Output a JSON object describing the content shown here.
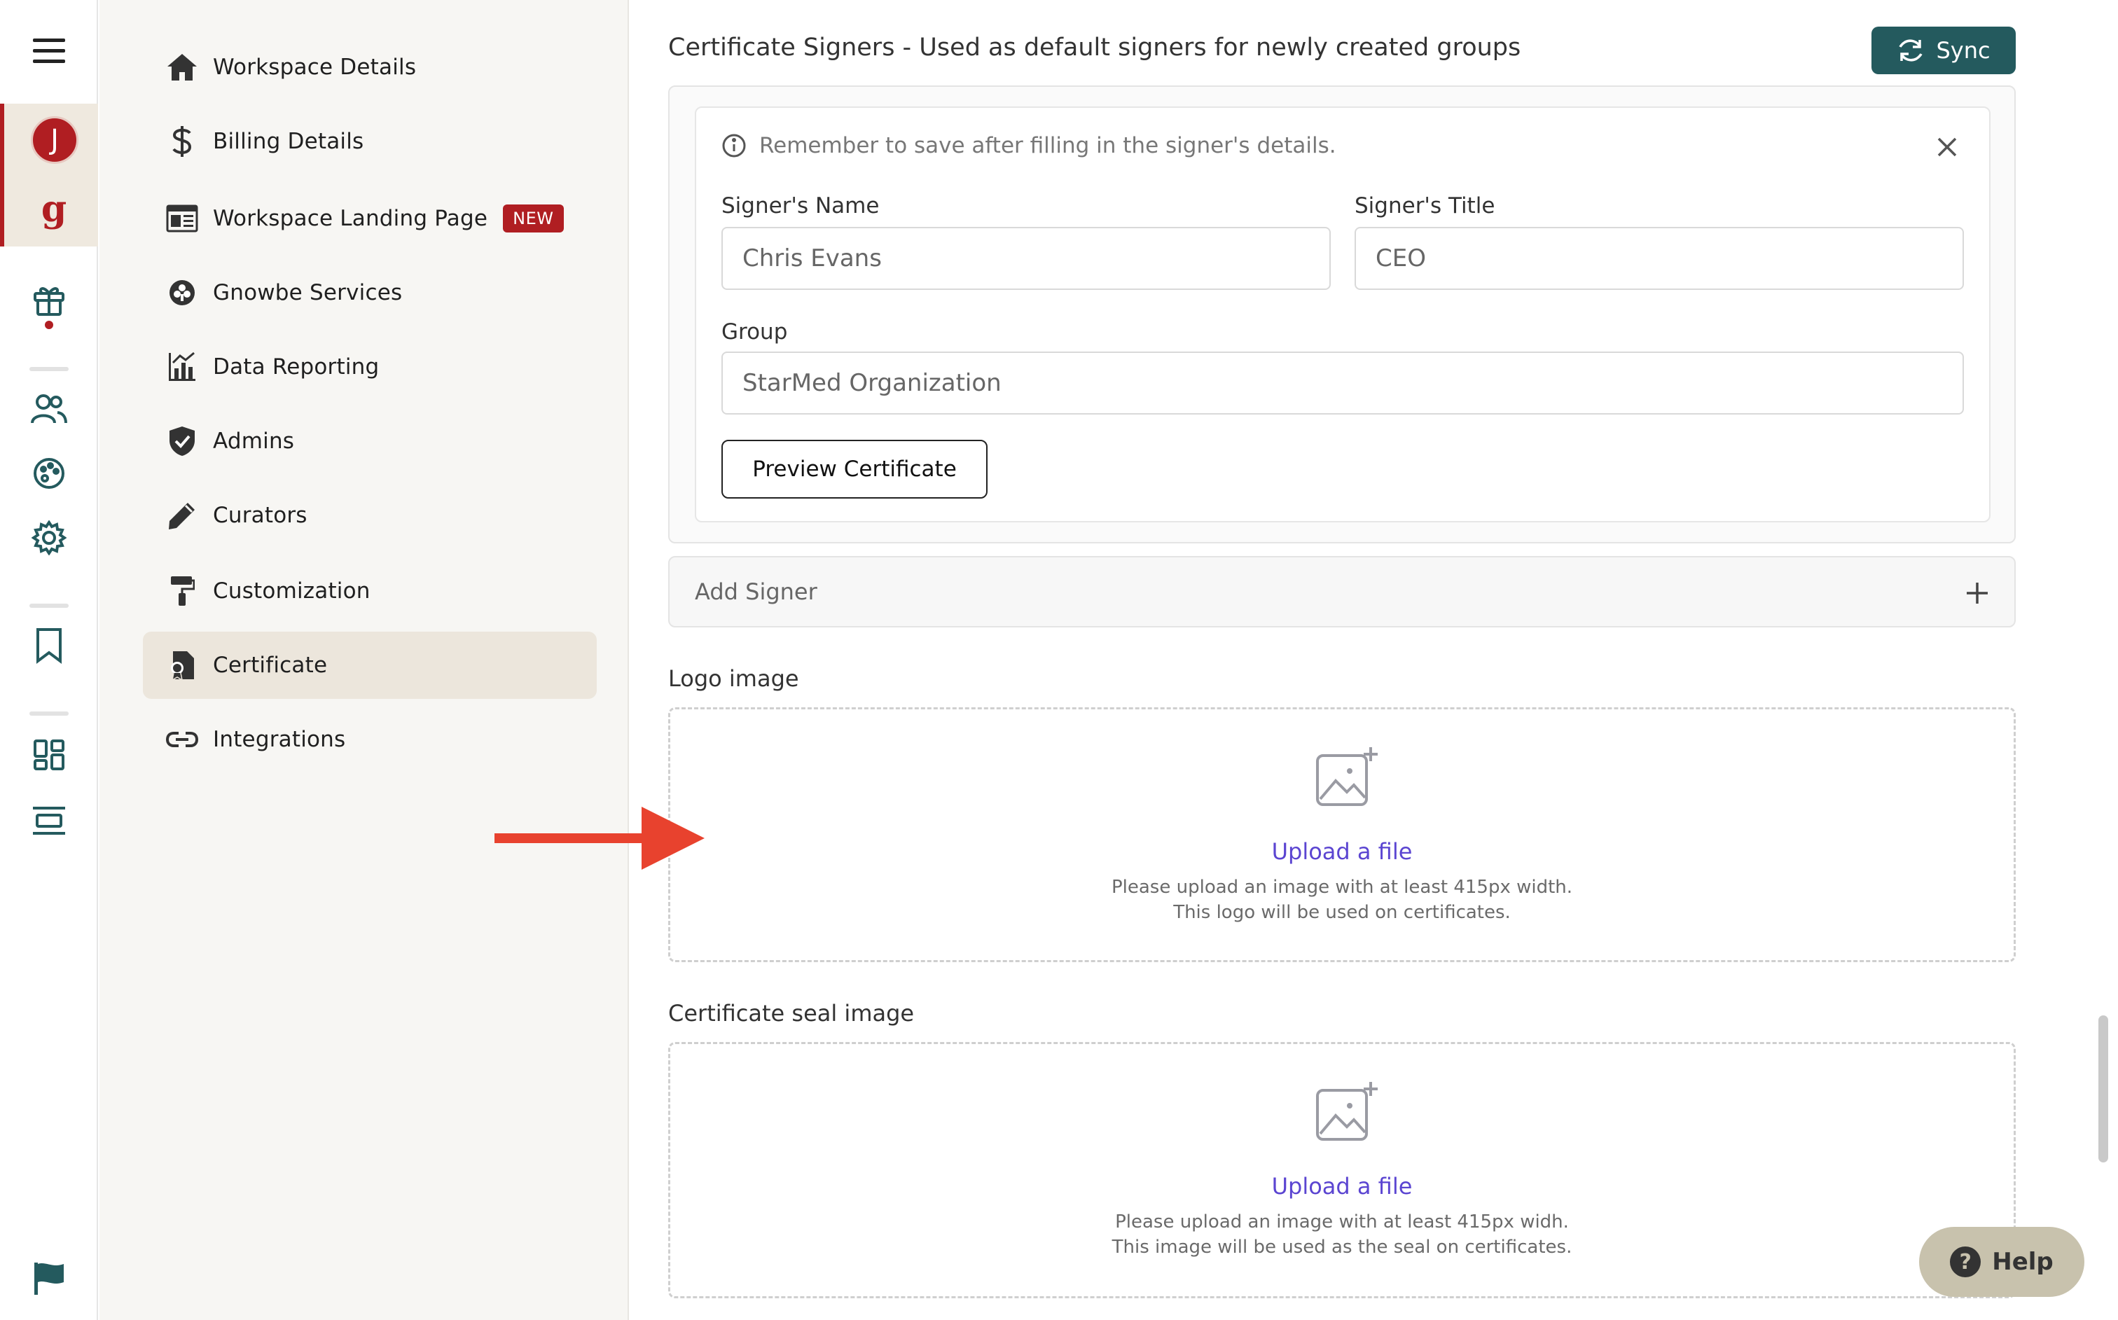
{
  "rail": {
    "avatar_initial": "J",
    "logo_letter": "g",
    "icons": [
      "menu-icon",
      "gift-icon",
      "users-icon",
      "palette-icon",
      "gear-icon",
      "bookmark-icon",
      "dashboard-icon",
      "layout-icon",
      "flag-icon"
    ]
  },
  "nav": {
    "items": [
      {
        "label": "Workspace Details",
        "icon": "home-icon"
      },
      {
        "label": "Billing Details",
        "icon": "dollar-icon"
      },
      {
        "label": "Workspace Landing Page",
        "icon": "landing-page-icon",
        "badge": "NEW"
      },
      {
        "label": "Gnowbe Services",
        "icon": "services-icon"
      },
      {
        "label": "Data Reporting",
        "icon": "chart-icon"
      },
      {
        "label": "Admins",
        "icon": "shield-icon"
      },
      {
        "label": "Curators",
        "icon": "pencil-icon"
      },
      {
        "label": "Customization",
        "icon": "paint-roller-icon"
      },
      {
        "label": "Certificate",
        "icon": "certificate-icon",
        "active": true
      },
      {
        "label": "Integrations",
        "icon": "link-icon"
      }
    ]
  },
  "main": {
    "section_title": "Certificate Signers - Used as default signers for newly created groups",
    "sync_label": "Sync",
    "notice": "Remember to save after filling in the signer's details.",
    "signer_name_label": "Signer's Name",
    "signer_name_value": "Chris Evans",
    "signer_title_label": "Signer's Title",
    "signer_title_value": "CEO",
    "group_label": "Group",
    "group_value": "StarMed Organization",
    "preview_label": "Preview Certificate",
    "add_signer_label": "Add Signer",
    "logo": {
      "label": "Logo image",
      "upload_label": "Upload a file",
      "hint_line1": "Please upload an image with at least 415px width.",
      "hint_line2": "This logo will be used on certificates."
    },
    "seal": {
      "label": "Certificate seal image",
      "upload_label": "Upload a file",
      "hint_line1": "Please upload an image with at least 415px widh.",
      "hint_line2": "This image will be used as the seal on certificates."
    }
  },
  "help_label": "Help",
  "colors": {
    "brand_red": "#b01e22",
    "sync_teal": "#245a5e",
    "link_purple": "#5b45d1",
    "annotation_arrow": "#e8422e"
  }
}
